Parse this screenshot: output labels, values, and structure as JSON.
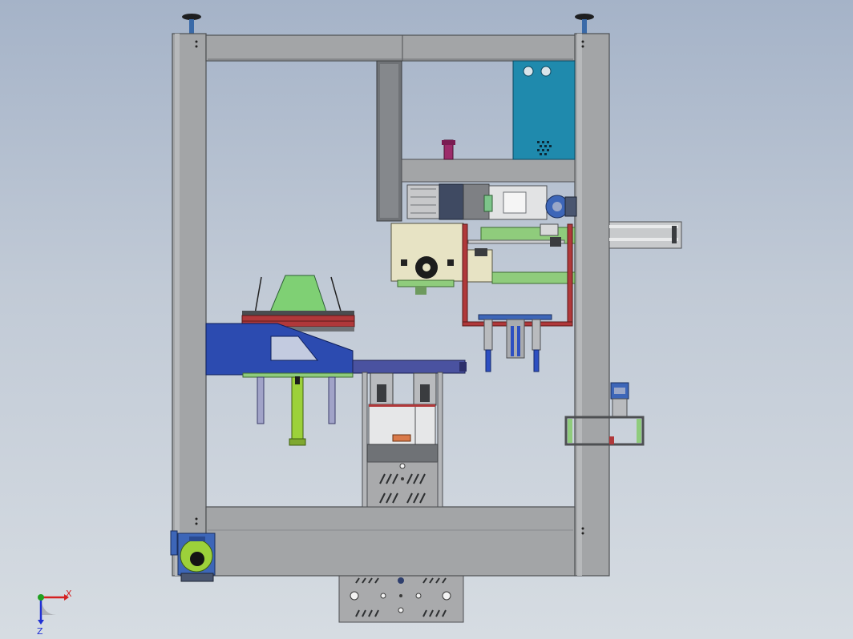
{
  "viewport": {
    "background_top": "#a5b3c8",
    "background_bottom": "#d6dce2"
  },
  "colors": {
    "frame_steel": "#a3a5a7",
    "frame_edge": "#4d4f52",
    "dark_steel": "#6f7276",
    "electrical_box": "#1f8aad",
    "motor_cream": "#e7e3c4",
    "bracket_green": "#8fcc7c",
    "hopper_green": "#7fd074",
    "carriage_blue": "#2c4bb0",
    "gearbox_blue": "#3d66b8",
    "actuator_red": "#b0383a",
    "shaft_yellowgreen": "#9cd13a",
    "knob_magenta": "#9c2b6a",
    "cylinder_blue": "#2d4fc1"
  },
  "triad": {
    "x_label": "X",
    "z_label": "Z",
    "x_color": "#d42020",
    "z_color": "#2030d4",
    "y_color": "#20a020"
  }
}
